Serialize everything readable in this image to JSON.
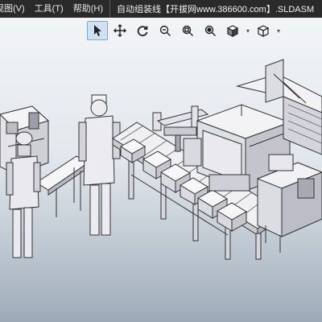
{
  "titlebar": {
    "menus": [
      {
        "label": "视图(V)"
      },
      {
        "label": "工具(T)"
      },
      {
        "label": "帮助(H)"
      }
    ],
    "window_title": "自动组装线【开拔网www.386600.com】.SLDASM"
  },
  "heads_up_toolbar": {
    "tools": [
      {
        "icon": "select-arrow-icon",
        "active": true
      },
      {
        "icon": "pan-icon"
      },
      {
        "icon": "rotate-view-icon"
      },
      {
        "icon": "zoom-to-fit-icon"
      },
      {
        "icon": "zoom-to-area-icon"
      },
      {
        "icon": "zoom-in-out-icon"
      },
      {
        "icon": "view-orientation-icon",
        "dropdown": true
      },
      {
        "icon": "display-style-icon",
        "dropdown": true
      }
    ]
  },
  "viewport": {
    "scene": "assembly-line-3d-model",
    "background_colors": [
      "#f2f4f6",
      "#a5b1bd"
    ]
  }
}
